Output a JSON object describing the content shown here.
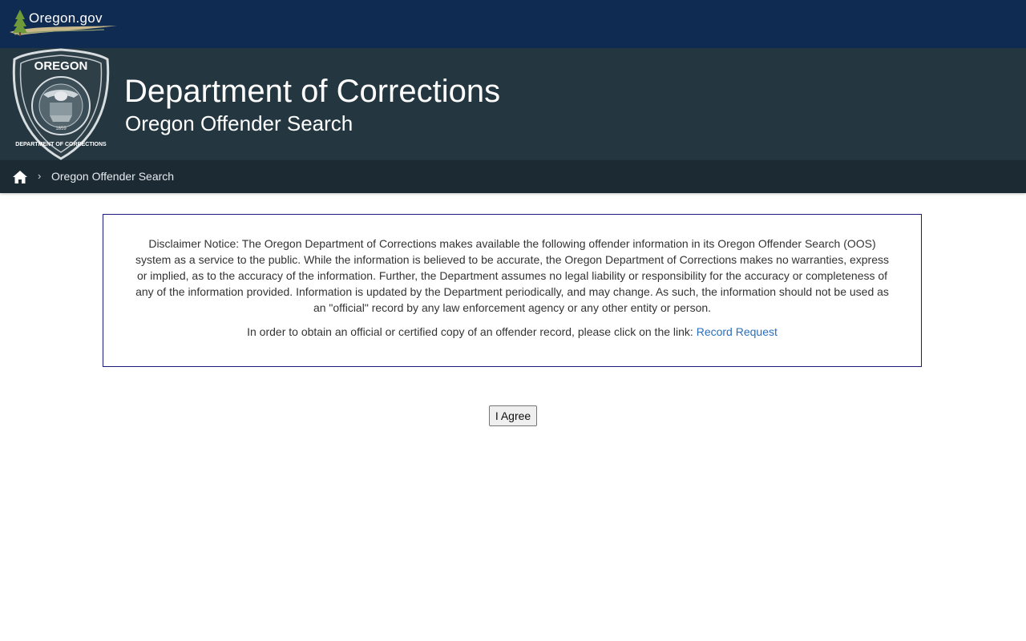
{
  "topbar": {
    "logo_text": "Oregon.gov",
    "logo_icon": "tree-icon"
  },
  "header": {
    "seal": {
      "top_text": "OREGON",
      "ring_text": "DEPARTMENT OF CORRECTIONS",
      "year": "1859"
    },
    "title": "Department of Corrections",
    "subtitle": "Oregon Offender Search"
  },
  "breadcrumb": {
    "home_icon": "home-icon",
    "separator": "›",
    "current": "Oregon Offender Search"
  },
  "notice": {
    "disclaimer": "Disclaimer Notice: The Oregon Department of Corrections makes available the following offender information in its Oregon Offender Search (OOS) system as a service to the public. While the information is believed to be accurate, the Oregon Department of Corrections makes no warranties, express or implied, as to the accuracy of the information. Further, the Department assumes no legal liability or responsibility for the accuracy or completeness of any of the information provided. Information is updated by the Department periodically, and may change. As such, the information should not be used as an \"official\" record by any law enforcement agency or any other entity or person.",
    "request_text": "In order to obtain an official or certified copy of an offender record, please click on the link:",
    "request_link": "Record Request"
  },
  "agree_button": "I Agree",
  "colors": {
    "topbar": "#0f2b52",
    "header": "#243640",
    "breadcrumb": "#1c2a33",
    "link": "#2a6ebb",
    "notice_border": "#1a1a7a"
  }
}
